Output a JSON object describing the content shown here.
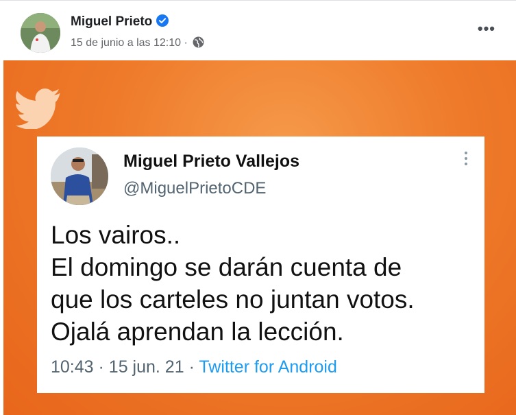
{
  "post": {
    "author": "Miguel Prieto",
    "timestamp": "15 de junio a las 12:10",
    "separator": "·",
    "more_label": "•••"
  },
  "tweet": {
    "name": "Miguel Prieto Vallejos",
    "handle": "@MiguelPrietoCDE",
    "lines": [
      "Los vairos..",
      "El domingo se darán cuenta de",
      "que los carteles no juntan votos.",
      "Ojalá aprendan la lección."
    ],
    "time": "10:43",
    "date": "15 jun. 21",
    "source": "Twitter for Android"
  },
  "colors": {
    "orange_background": "#ee7a2a",
    "verified_badge": "#1877f2",
    "twitter_link": "#1d9bf0"
  }
}
